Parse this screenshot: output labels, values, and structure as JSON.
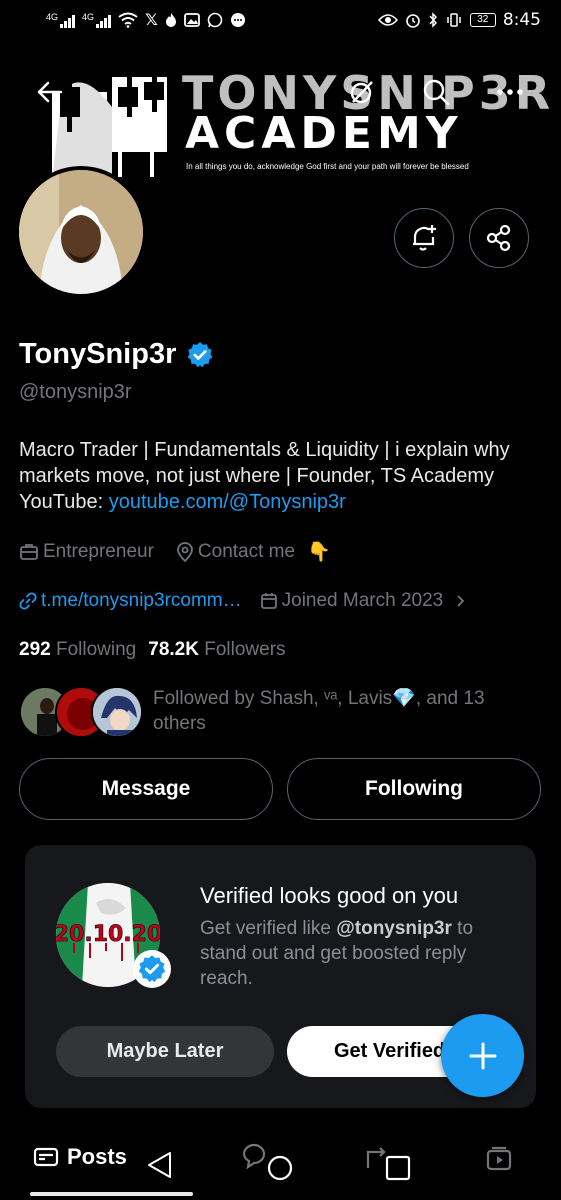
{
  "status_bar": {
    "signal_1": "4G",
    "signal_2": "4G",
    "battery": "32",
    "time": "8:45"
  },
  "banner": {
    "title_line1": "TONYSNIP3R",
    "title_line2": "ACADEMY",
    "tagline": "In all things you do, acknowledge God first and your path will forever be blessed"
  },
  "profile": {
    "display_name": "TonySnip3r",
    "handle": "@tonysnip3r",
    "bio_text": "Macro Trader | Fundamentals & Liquidity | i explain why markets move, not just where | Founder, TS Academy YouTube: ",
    "bio_link": "youtube.com/@Tonysnip3r",
    "category": "Entrepreneur",
    "location": "Contact me",
    "location_emoji": "👇",
    "website": "t.me/tonysnip3rcomm…",
    "joined": "Joined March 2023",
    "following_count": "292",
    "following_label": "Following",
    "followers_count": "78.2K",
    "followers_label": "Followers",
    "followed_by": "Followed by Shash, ᵛᵃ, Lavis💎, and 13 others"
  },
  "actions": {
    "message": "Message",
    "following": "Following"
  },
  "verified_card": {
    "avatar_text": "20.10.20",
    "title": "Verified looks good on you",
    "desc_before": "Get verified like ",
    "desc_handle": "@tonysnip3r",
    "desc_after": " to stand out and get boosted reply reach.",
    "maybe_later": "Maybe Later",
    "get_verified": "Get Verified"
  },
  "tabs": {
    "posts": "Posts"
  },
  "colors": {
    "accent": "#1d9bf0",
    "background": "#000000",
    "card": "#16181c",
    "muted": "#71767b"
  }
}
